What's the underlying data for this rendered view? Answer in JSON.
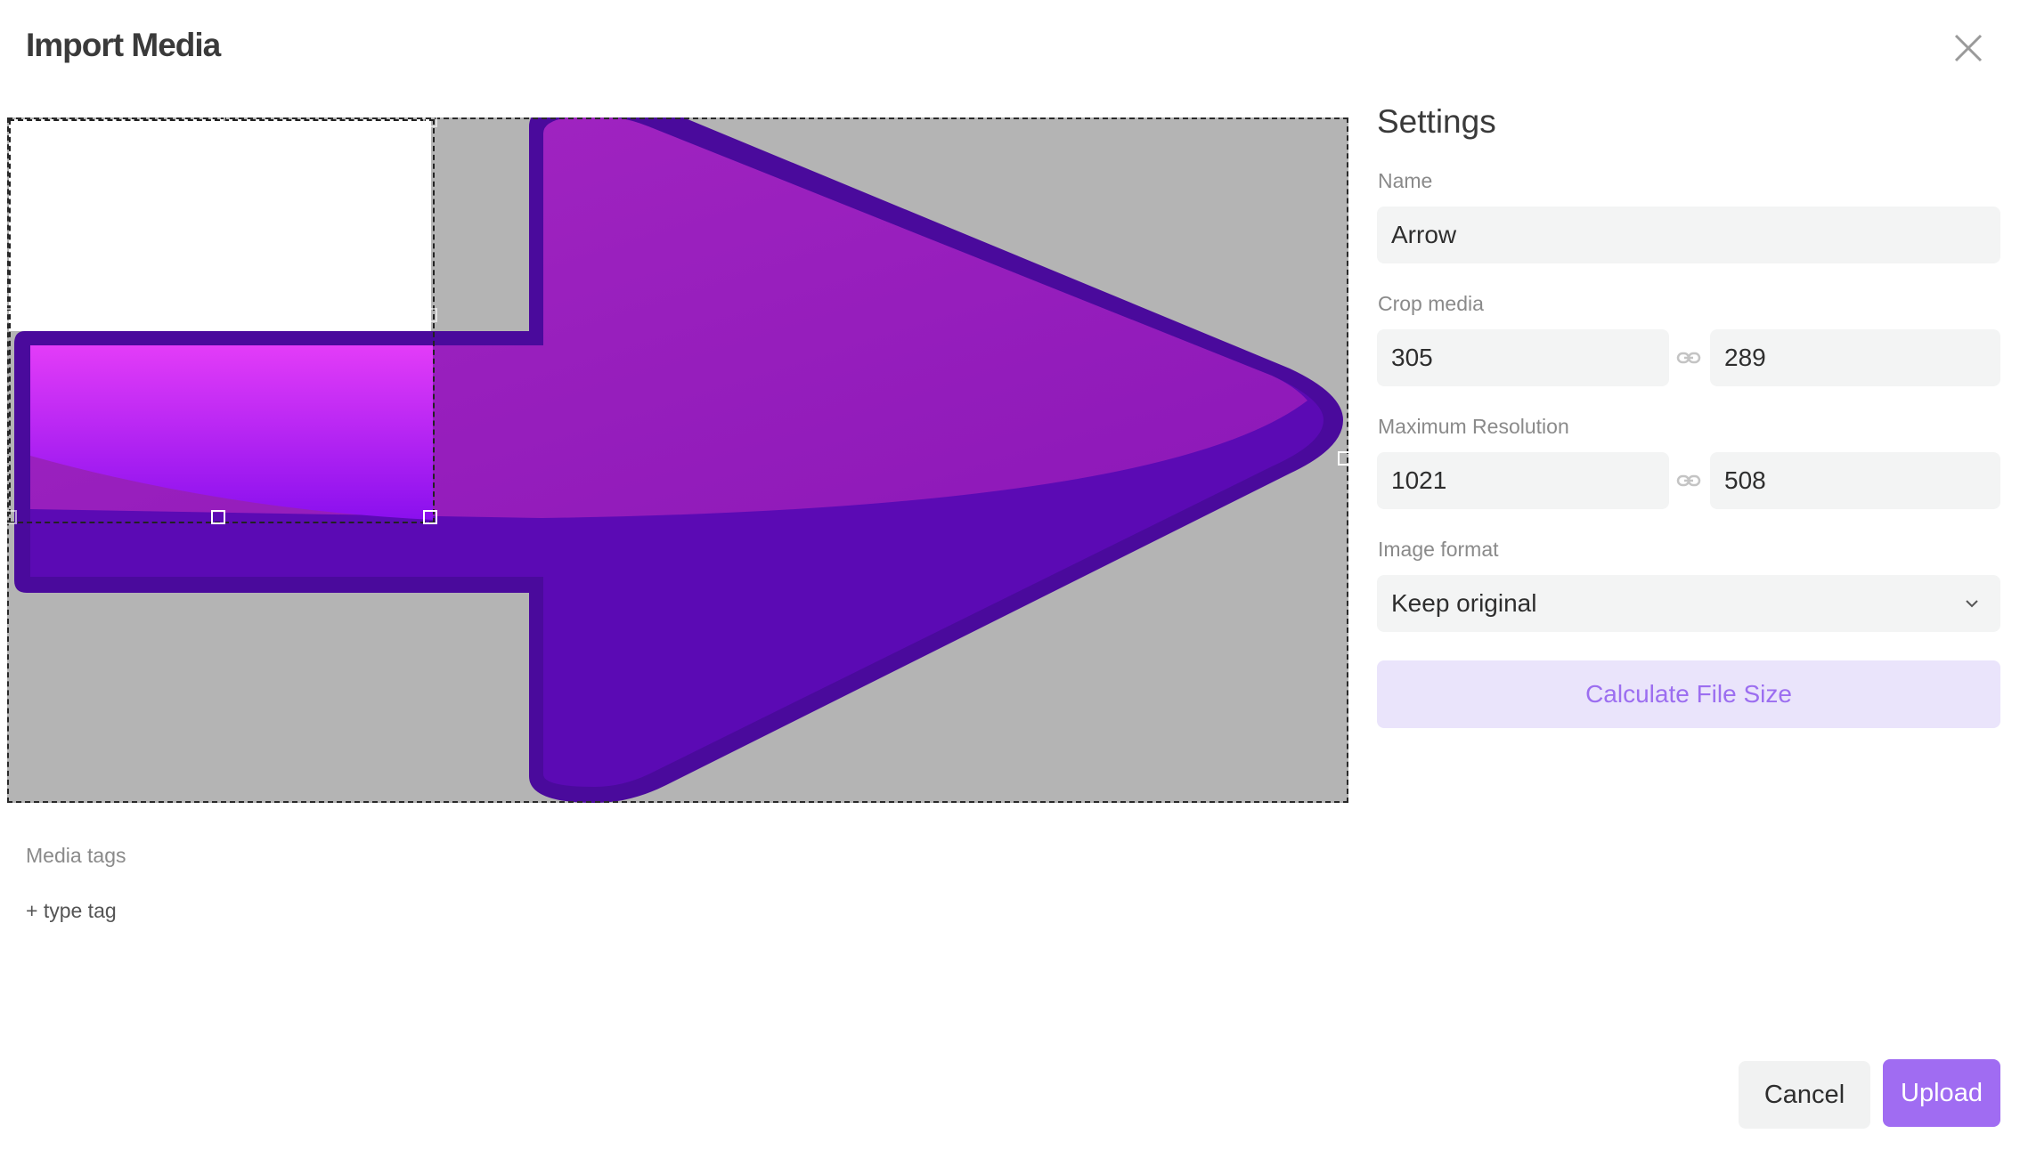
{
  "dialog": {
    "title": "Import Media",
    "close_icon": "close-icon"
  },
  "editor": {
    "image_name": "Arrow",
    "crop_handles": 8
  },
  "tags": {
    "label": "Media tags",
    "add_placeholder": "+ type tag"
  },
  "settings": {
    "title": "Settings",
    "name_label": "Name",
    "name_value": "Arrow",
    "crop_label": "Crop media",
    "crop_width": "305",
    "crop_height": "289",
    "resolution_label": "Maximum Resolution",
    "resolution_width": "1021",
    "resolution_height": "508",
    "format_label": "Image format",
    "format_value": "Keep original",
    "calculate_label": "Calculate File Size",
    "link_icon": "link-icon"
  },
  "footer": {
    "cancel_label": "Cancel",
    "upload_label": "Upload"
  },
  "colors": {
    "accent": "#a06cf2",
    "accent_light": "#eae4fb",
    "arrow_purple": "#6a0fc4",
    "canvas_bg": "#b4b4b4"
  }
}
